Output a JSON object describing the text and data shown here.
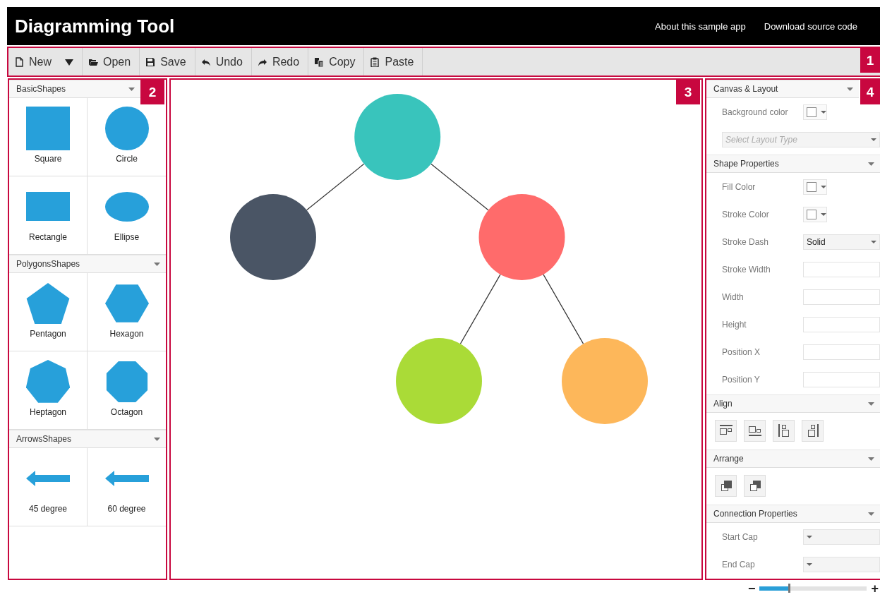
{
  "header": {
    "title": "Diagramming Tool",
    "links": [
      "About this sample app",
      "Download source code"
    ]
  },
  "toolbar": {
    "callout": "1",
    "buttons": [
      {
        "kind": "new",
        "label": "New",
        "dropdown": true
      },
      {
        "kind": "open",
        "label": "Open",
        "dropdown": false
      },
      {
        "kind": "save",
        "label": "Save",
        "dropdown": false
      },
      {
        "kind": "undo",
        "label": "Undo",
        "dropdown": false
      },
      {
        "kind": "redo",
        "label": "Redo",
        "dropdown": false
      },
      {
        "kind": "copy",
        "label": "Copy",
        "dropdown": false
      },
      {
        "kind": "paste",
        "label": "Paste",
        "dropdown": false
      }
    ]
  },
  "palette": {
    "callout": "2",
    "groups": [
      {
        "title": "BasicShapes",
        "expanded": true,
        "items": [
          {
            "kind": "square",
            "label": "Square"
          },
          {
            "kind": "circle",
            "label": "Circle"
          },
          {
            "kind": "rectangle",
            "label": "Rectangle"
          },
          {
            "kind": "ellipse",
            "label": "Ellipse"
          }
        ]
      },
      {
        "title": "PolygonsShapes",
        "expanded": true,
        "items": [
          {
            "kind": "pentagon",
            "label": "Pentagon"
          },
          {
            "kind": "hexagon",
            "label": "Hexagon"
          },
          {
            "kind": "heptagon",
            "label": "Heptagon"
          },
          {
            "kind": "octagon",
            "label": "Octagon"
          }
        ]
      },
      {
        "title": "ArrowsShapes",
        "expanded": true,
        "items": [
          {
            "kind": "arrow",
            "label": "45 degree"
          },
          {
            "kind": "arrow",
            "label": "60 degree"
          }
        ]
      }
    ]
  },
  "canvas": {
    "callout": "3",
    "diagram": {
      "root": {
        "color": "#39c4bc",
        "children": [
          {
            "color": "#4a5565"
          },
          {
            "color": "#ff6b6b",
            "children": [
              {
                "color": "#aadb37"
              },
              {
                "color": "#fdb75a"
              }
            ]
          }
        ]
      }
    }
  },
  "properties": {
    "callout": "4",
    "sections": [
      {
        "title": "Canvas & Layout",
        "expanded": true,
        "rows": [
          {
            "kind": "color",
            "label": "Background color"
          },
          {
            "kind": "select",
            "placeholder": "Select Layout Type"
          }
        ]
      },
      {
        "title": "Shape Properties",
        "expanded": true,
        "rows": [
          {
            "kind": "color",
            "label": "Fill Color"
          },
          {
            "kind": "color",
            "label": "Stroke Color"
          },
          {
            "kind": "select",
            "label": "Stroke Dash",
            "value": "Solid"
          },
          {
            "kind": "text",
            "label": "Stroke Width"
          },
          {
            "kind": "text",
            "label": "Width"
          },
          {
            "kind": "text",
            "label": "Height"
          },
          {
            "kind": "text",
            "label": "Position X"
          },
          {
            "kind": "text",
            "label": "Position Y"
          }
        ]
      },
      {
        "title": "Align",
        "expanded": true,
        "rows": [
          {
            "kind": "tools",
            "tools": [
              {
                "kind": "align-top"
              },
              {
                "kind": "align-bottom"
              },
              {
                "kind": "align-left"
              },
              {
                "kind": "align-right"
              }
            ]
          }
        ]
      },
      {
        "title": "Arrange",
        "expanded": true,
        "rows": [
          {
            "kind": "tools",
            "tools": [
              {
                "kind": "bring-front"
              },
              {
                "kind": "send-back"
              }
            ]
          }
        ]
      },
      {
        "title": "Connection Properties",
        "expanded": true,
        "rows": [
          {
            "kind": "select",
            "label": "Start Cap"
          },
          {
            "kind": "select",
            "label": "End Cap"
          }
        ]
      }
    ]
  },
  "zoom": {
    "minus": "−",
    "plus": "+",
    "level": 0.27
  }
}
